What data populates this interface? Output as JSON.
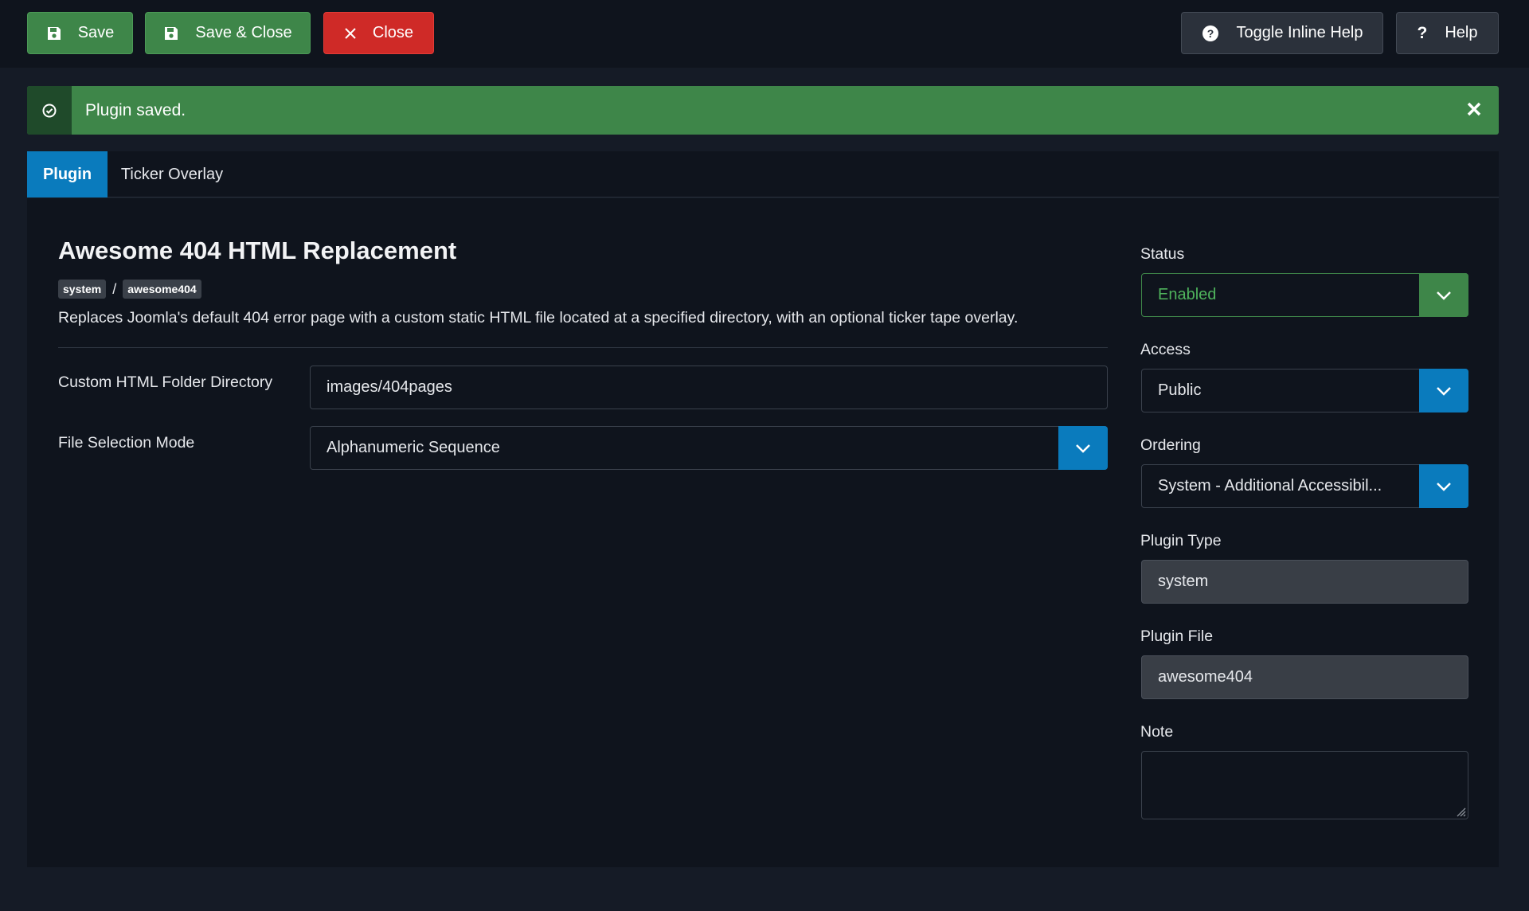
{
  "toolbar": {
    "save_label": "Save",
    "save_close_label": "Save & Close",
    "close_label": "Close",
    "toggle_help_label": "Toggle Inline Help",
    "help_label": "Help"
  },
  "alert": {
    "message": "Plugin saved."
  },
  "tabs": [
    {
      "label": "Plugin",
      "active": true
    },
    {
      "label": "Ticker Overlay",
      "active": false
    }
  ],
  "plugin": {
    "title": "Awesome 404 HTML Replacement",
    "badge_group": "system",
    "badge_separator": "/",
    "badge_element": "awesome404",
    "description": "Replaces Joomla's default 404 error page with a custom static HTML file located at a specified directory, with an optional ticker tape overlay."
  },
  "fields": {
    "folder_label": "Custom HTML Folder Directory",
    "folder_value": "images/404pages",
    "mode_label": "File Selection Mode",
    "mode_value": "Alphanumeric Sequence"
  },
  "sidebar": {
    "status_label": "Status",
    "status_value": "Enabled",
    "access_label": "Access",
    "access_value": "Public",
    "ordering_label": "Ordering",
    "ordering_value": "System - Additional Accessibil...",
    "type_label": "Plugin Type",
    "type_value": "system",
    "file_label": "Plugin File",
    "file_value": "awesome404",
    "note_label": "Note",
    "note_value": ""
  },
  "colors": {
    "green": "#3e8649",
    "red": "#cf2a27",
    "blue": "#0a7bbd",
    "panel": "#0f141d",
    "background": "#151b26"
  }
}
